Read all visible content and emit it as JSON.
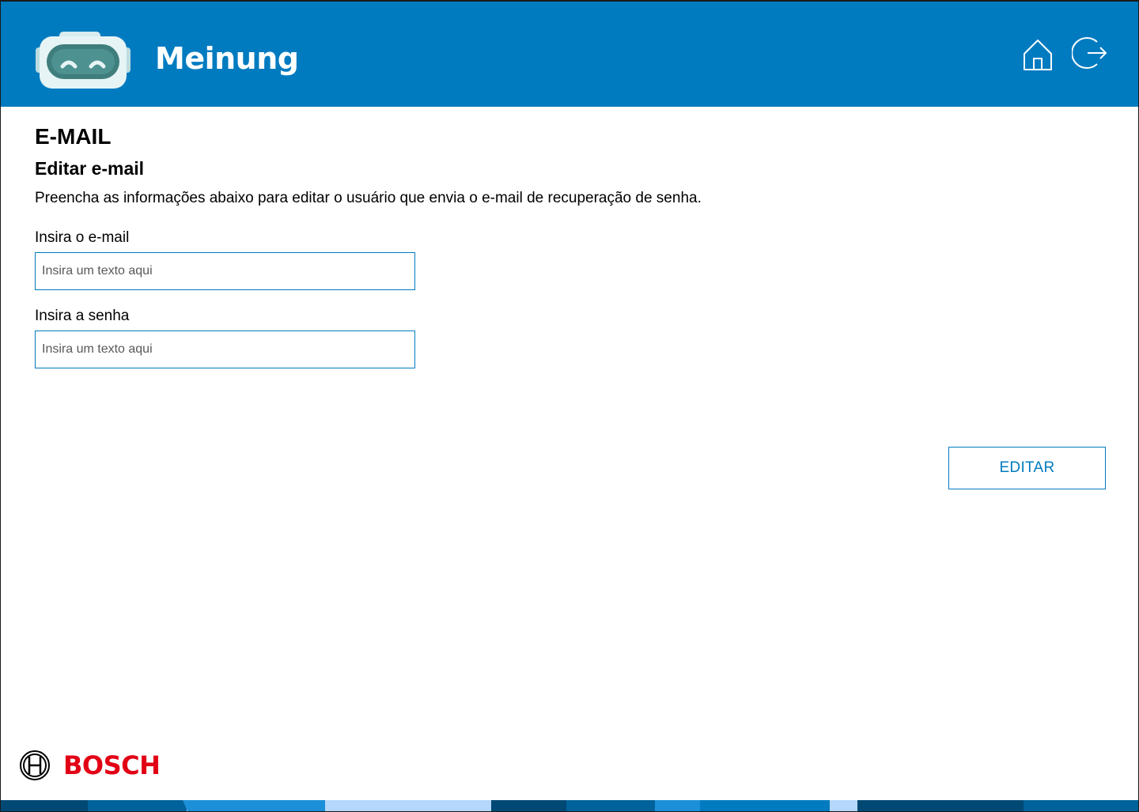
{
  "app": {
    "title": "Meinung",
    "brand": "BOSCH"
  },
  "colors": {
    "header_bg": "#007bc0",
    "accent": "#007bc0",
    "brand_red": "#e20015"
  },
  "header_icons": {
    "home": "home-icon",
    "logout": "logout-icon"
  },
  "page": {
    "title": "E-MAIL",
    "section_title": "Editar e-mail",
    "description": "Preencha as informações abaixo para editar o usuário que envia o e-mail de recuperação de senha."
  },
  "form": {
    "email": {
      "label": "Insira o e-mail",
      "placeholder": "Insira um texto aqui",
      "value": ""
    },
    "password": {
      "label": "Insira a senha",
      "placeholder": "Insira um texto aqui",
      "value": ""
    },
    "submit_label": "EDITAR"
  }
}
